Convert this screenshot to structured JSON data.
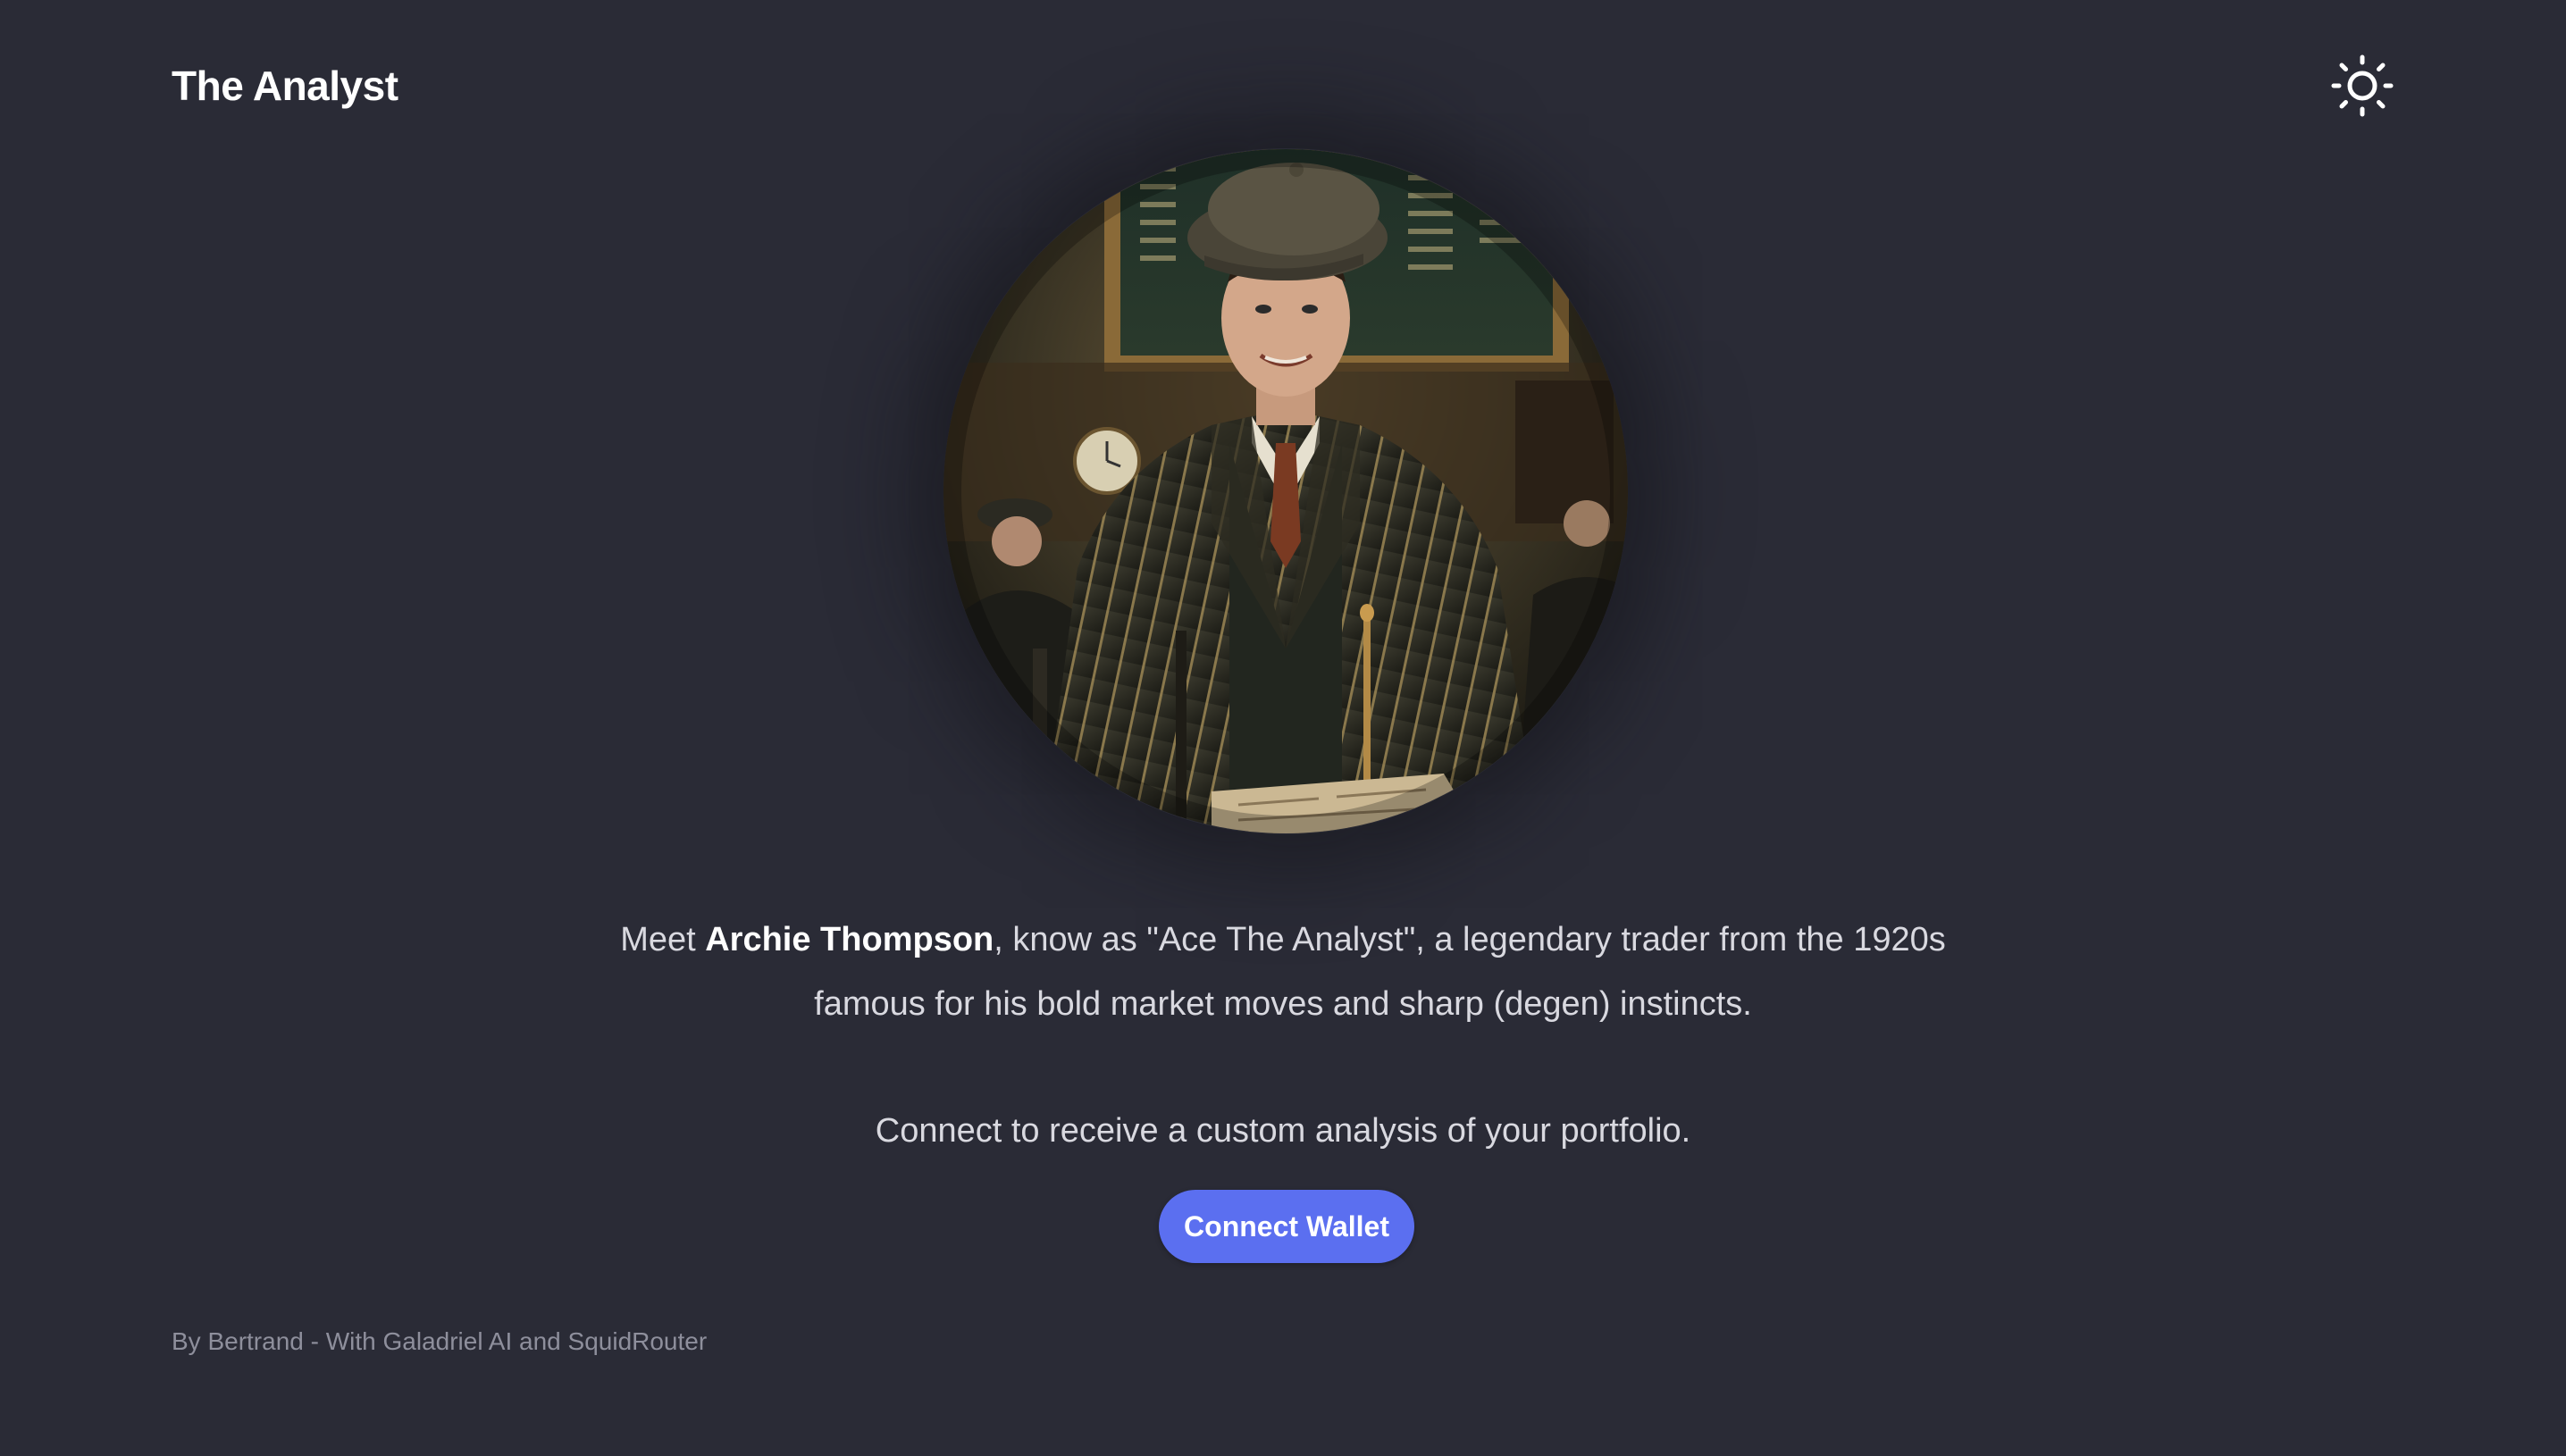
{
  "header": {
    "brand": "The Analyst",
    "theme_icon": "sun-icon"
  },
  "hero": {
    "portrait_alt": "portrait-image"
  },
  "intro": {
    "prefix": "Meet ",
    "name": "Archie Thompson",
    "suffix": ", know as \"Ace The Analyst\", a legendary trader from the 1920s",
    "line2": "famous for his bold market moves and sharp (degen) instincts."
  },
  "cta": {
    "text": "Connect to receive a custom analysis of your portfolio.",
    "button_label": "Connect Wallet"
  },
  "footer": {
    "credit": "By Bertrand - With Galadriel AI and SquidRouter"
  },
  "colors": {
    "background": "#2a2b36",
    "accent": "#5b6ff0",
    "text": "#d9d9e0",
    "muted": "#8e8f9c"
  }
}
